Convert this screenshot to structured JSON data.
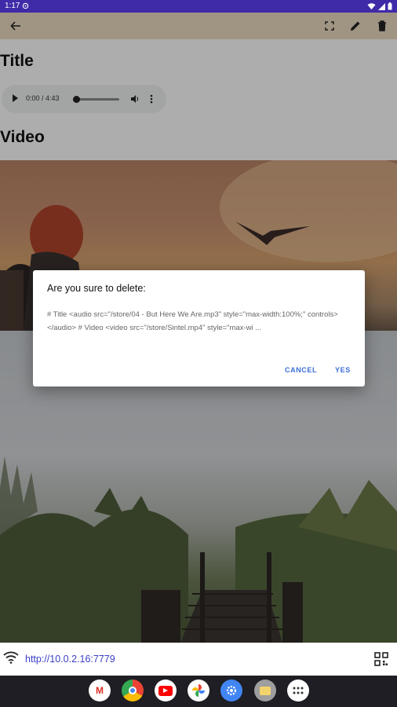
{
  "status_bar": {
    "time": "1:17"
  },
  "app_bar": {
    "back_icon": "arrow-back-icon",
    "actions": [
      "fullscreen-icon",
      "edit-icon",
      "delete-icon"
    ]
  },
  "content": {
    "heading_title": "Title",
    "audio": {
      "time": "0:00 / 4:43",
      "progress": 0
    },
    "heading_video": "Video"
  },
  "dialog": {
    "title": "Are you sure to delete:",
    "body": "# Title <audio src=\"/store/04 - But Here We Are.mp3\" style=\"max-width:100%;\" controls></audio> # Video <video src=\"/store/Sintel.mp4\" style=\"max-wi ...",
    "cancel_label": "CANCEL",
    "yes_label": "YES"
  },
  "bottom_bar": {
    "url": "http://10.0.2.16:7779"
  },
  "dock": {
    "apps": [
      "gmail-icon",
      "chrome-icon",
      "youtube-icon",
      "photos-icon",
      "settings-icon",
      "files-icon",
      "app-drawer-icon"
    ],
    "gmail_glyph": "M"
  },
  "colors": {
    "status_bar": "#3f2aa8",
    "app_bar": "#ecdcc2",
    "accent": "#3b6dd8",
    "link": "#3a40c8",
    "nav_bar": "#1e1e24"
  }
}
